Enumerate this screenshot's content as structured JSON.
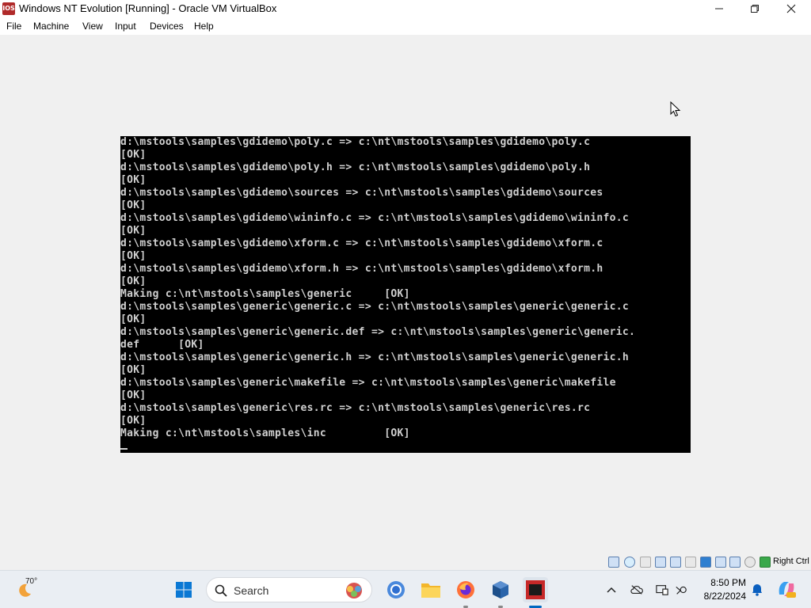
{
  "window": {
    "app_icon_text": "IOS",
    "title": "Windows NT Evolution [Running] - Oracle VM VirtualBox",
    "minimize_icon": "minimize-icon",
    "maximize_icon": "maximize-icon",
    "close_icon": "close-icon"
  },
  "menu": [
    "File",
    "Machine",
    "View",
    "Input",
    "Devices",
    "Help"
  ],
  "console": {
    "lines": [
      "d:\\mstools\\samples\\gdidemo\\poly.c => c:\\nt\\mstools\\samples\\gdidemo\\poly.c",
      "[OK]",
      "d:\\mstools\\samples\\gdidemo\\poly.h => c:\\nt\\mstools\\samples\\gdidemo\\poly.h",
      "[OK]",
      "d:\\mstools\\samples\\gdidemo\\sources => c:\\nt\\mstools\\samples\\gdidemo\\sources",
      "[OK]",
      "d:\\mstools\\samples\\gdidemo\\wininfo.c => c:\\nt\\mstools\\samples\\gdidemo\\wininfo.c",
      "[OK]",
      "d:\\mstools\\samples\\gdidemo\\xform.c => c:\\nt\\mstools\\samples\\gdidemo\\xform.c",
      "[OK]",
      "d:\\mstools\\samples\\gdidemo\\xform.h => c:\\nt\\mstools\\samples\\gdidemo\\xform.h",
      "[OK]",
      "Making c:\\nt\\mstools\\samples\\generic     [OK]",
      "d:\\mstools\\samples\\generic\\generic.c => c:\\nt\\mstools\\samples\\generic\\generic.c",
      "[OK]",
      "d:\\mstools\\samples\\generic\\generic.def => c:\\nt\\mstools\\samples\\generic\\generic.",
      "def      [OK]",
      "d:\\mstools\\samples\\generic\\generic.h => c:\\nt\\mstools\\samples\\generic\\generic.h",
      "[OK]",
      "d:\\mstools\\samples\\generic\\makefile => c:\\nt\\mstools\\samples\\generic\\makefile",
      "[OK]",
      "d:\\mstools\\samples\\generic\\res.rc => c:\\nt\\mstools\\samples\\generic\\res.rc",
      "[OK]",
      "Making c:\\nt\\mstools\\samples\\inc         [OK]"
    ],
    "colors": {
      "background": "#000000",
      "text": "#d0d0d0"
    }
  },
  "statusbar": {
    "icons": [
      "hard-disk-icon",
      "optical-drive-icon",
      "audio-icon",
      "network-icon",
      "usb-icon",
      "shared-folder-icon",
      "display-icon",
      "recording-icon",
      "clipboard-icon",
      "mouse-integration-icon",
      "cpu-icon",
      "host-key-icon"
    ],
    "host_key": "Right Ctrl"
  },
  "taskbar": {
    "weather_temp": "70°",
    "search_placeholder": "Search",
    "apps": [
      "start-button",
      "search-box",
      "copilot-icon",
      "chrome-icon",
      "file-explorer-icon",
      "firefox-icon",
      "virtualbox-icon",
      "dos-app-icon"
    ],
    "clock_time": "8:50 PM",
    "clock_date": "8/22/2024",
    "accent": "#0067c0"
  }
}
